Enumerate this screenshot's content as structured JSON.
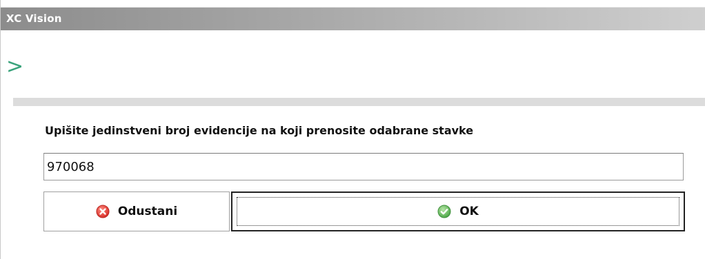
{
  "window": {
    "title": "XC Vision"
  },
  "header": {
    "prompt_glyph": ">"
  },
  "form": {
    "instruction": "Upišite jedinstveni broj evidencije na koji prenosite odabrane stavke",
    "input_value": "970068"
  },
  "buttons": {
    "cancel_label": "Odustani",
    "cancel_icon": "cancel-icon",
    "ok_label": "OK",
    "ok_icon": "check-icon"
  },
  "colors": {
    "accent_prompt": "#3aa37c",
    "cancel_icon": "#e0463f",
    "ok_icon": "#5cb85c"
  }
}
